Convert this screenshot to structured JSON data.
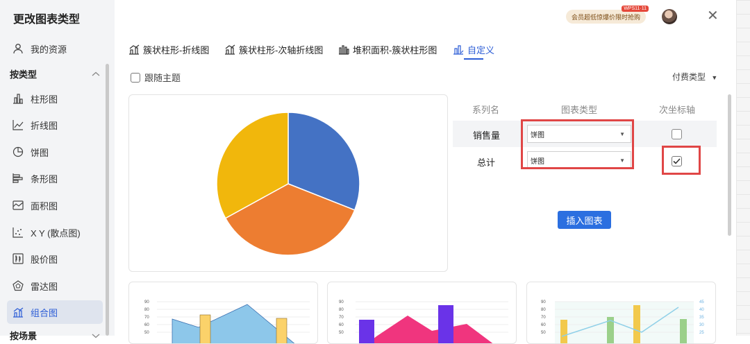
{
  "sidebar": {
    "title": "更改图表类型",
    "my_resources": "我的资源",
    "group_by_type": "按类型",
    "group_by_scene": "按场景",
    "items": [
      {
        "label": "柱形图",
        "icon": "bar-chart-icon"
      },
      {
        "label": "折线图",
        "icon": "line-chart-icon"
      },
      {
        "label": "饼图",
        "icon": "pie-chart-icon"
      },
      {
        "label": "条形图",
        "icon": "horizontal-bar-icon"
      },
      {
        "label": "面积图",
        "icon": "area-chart-icon"
      },
      {
        "label": "X Y (散点图)",
        "icon": "scatter-icon"
      },
      {
        "label": "股价图",
        "icon": "stock-chart-icon"
      },
      {
        "label": "雷达图",
        "icon": "radar-chart-icon"
      },
      {
        "label": "组合图",
        "icon": "combo-chart-icon",
        "active": true
      }
    ]
  },
  "header": {
    "promo_text": "会员超低惊爆价限时抢购",
    "promo_tag": "WPS11·11"
  },
  "tabs": [
    {
      "label": "簇状柱形-折线图"
    },
    {
      "label": "簇状柱形-次轴折线图"
    },
    {
      "label": "堆积面积-簇状柱形图"
    },
    {
      "label": "自定义",
      "active": true
    }
  ],
  "options": {
    "follow_theme": "跟随主题",
    "fee_type": "付费类型"
  },
  "table": {
    "headers": [
      "系列名",
      "图表类型",
      "次坐标轴"
    ],
    "rows": [
      {
        "name": "销售量",
        "chart_type": "饼图",
        "secondary_axis": false
      },
      {
        "name": "总计",
        "chart_type": "饼图",
        "secondary_axis": true
      }
    ]
  },
  "insert_button": "插入图表",
  "colors": {
    "accent": "#2b5cd6",
    "button": "#2b6fe0",
    "highlight": "#e04646",
    "pie_blue": "#4472c4",
    "pie_orange": "#ed7d31",
    "pie_yellow": "#f1b70c"
  },
  "chart_data": [
    {
      "type": "pie",
      "categories": [
        "",
        "",
        ""
      ],
      "values": [
        31,
        36,
        33
      ]
    },
    {
      "type": "area",
      "yticks": [
        "90",
        "80",
        "70",
        "60",
        "50"
      ]
    },
    {
      "type": "area",
      "yticks": [
        "90",
        "80",
        "70",
        "60",
        "50"
      ]
    },
    {
      "type": "bar",
      "yticks": [
        "90",
        "80",
        "70",
        "60",
        "50"
      ],
      "y2ticks": [
        "45",
        "40",
        "35",
        "30",
        "25"
      ]
    }
  ]
}
